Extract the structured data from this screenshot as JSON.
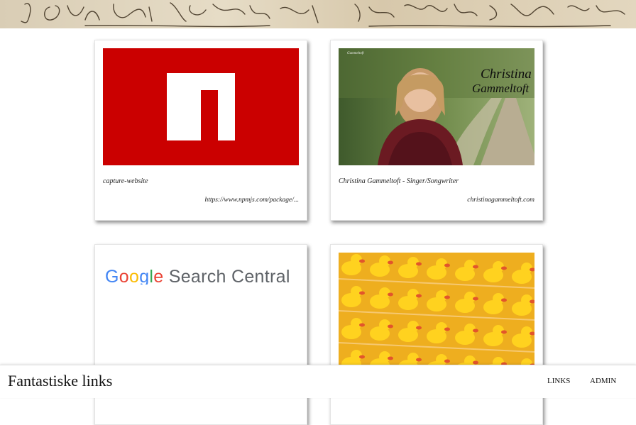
{
  "site": {
    "title": "Fantastiske links"
  },
  "nav": {
    "links_label": "LINKS",
    "admin_label": "ADMIN"
  },
  "header_image": {
    "handwriting": "Ik hoop dat Mijn Wens ... Uw Hooghijd ... ik Zal het Mijn"
  },
  "cards": [
    {
      "title": "capture-website",
      "url": "https://www.npmjs.com/package/...",
      "thumb": "npm-logo"
    },
    {
      "title": "Christina Gammeltoft - Singer/Songwriter",
      "url": "christinagammeltoft.com",
      "thumb": "portrait-photo",
      "thumb_text": "Christina Gammeltoft"
    },
    {
      "title": "",
      "url": "",
      "thumb": "google-search-central-logo",
      "thumb_text": "Google Search Central"
    },
    {
      "title": "",
      "url": "",
      "thumb": "rubber-ducks-photo"
    }
  ],
  "colors": {
    "npm_red": "#cb0000",
    "google_blue": "#4285f4",
    "google_red": "#ea4335",
    "google_yellow": "#fbbc05",
    "google_green": "#34a853"
  }
}
